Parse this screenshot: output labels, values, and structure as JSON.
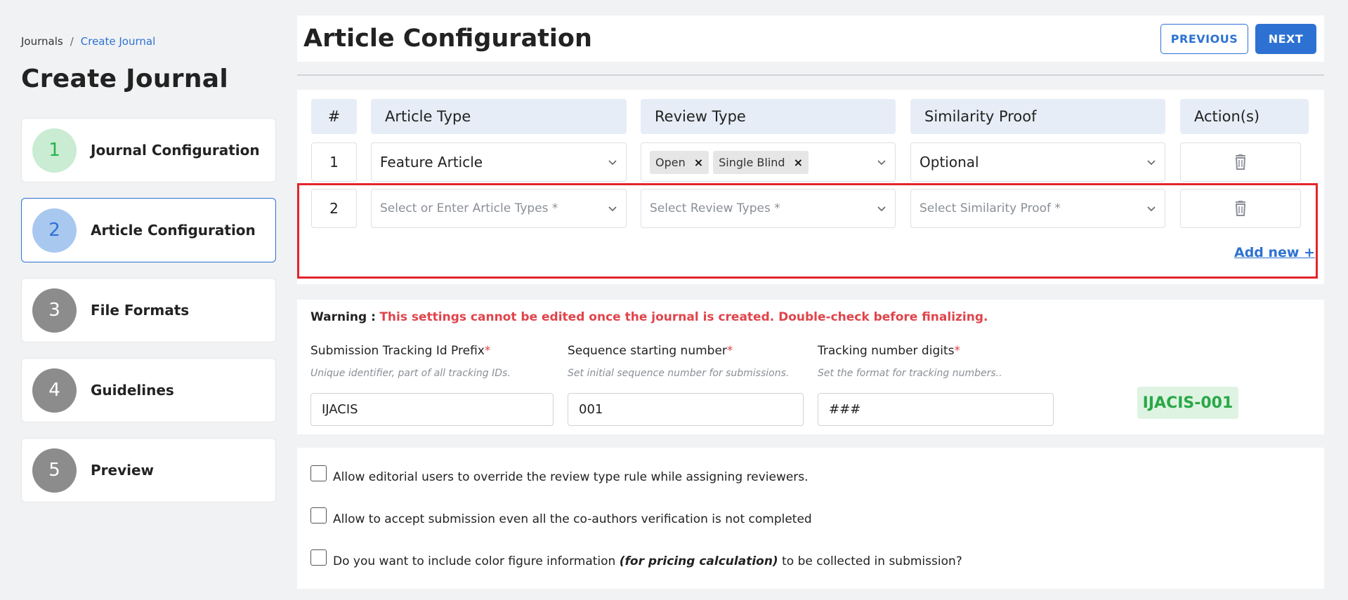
{
  "breadcrumb": {
    "root": "Journals",
    "separator": "/",
    "current": "Create Journal"
  },
  "page_title": "Create Journal",
  "steps": [
    {
      "number": "1",
      "label": "Journal Configuration"
    },
    {
      "number": "2",
      "label": "Article Configuration"
    },
    {
      "number": "3",
      "label": "File Formats"
    },
    {
      "number": "4",
      "label": "Guidelines"
    },
    {
      "number": "5",
      "label": "Preview"
    }
  ],
  "header": {
    "title": "Article Configuration",
    "previous_label": "PREVIOUS",
    "next_label": "NEXT"
  },
  "table": {
    "columns": [
      "#",
      "Article Type",
      "Review Type",
      "Similarity Proof",
      "Action(s)"
    ],
    "rows": [
      {
        "num": "1",
        "article_type": "Feature Article",
        "review_types": [
          "Open",
          "Single Blind"
        ],
        "similarity_proof": "Optional"
      },
      {
        "num": "2",
        "article_type_placeholder": "Select or Enter Article Types *",
        "review_type_placeholder": "Select Review Types *",
        "similarity_proof_placeholder": "Select Similarity Proof *"
      }
    ],
    "add_new_label": "Add new +",
    "chip_remove_glyph": "×"
  },
  "warning": {
    "label": "Warning :",
    "text": "This settings cannot be edited once the journal is created. Double-check before finalizing."
  },
  "tracking": {
    "required_mark": "*",
    "prefix": {
      "label": "Submission Tracking Id Prefix",
      "hint": "Unique identifier, part of all tracking IDs.",
      "value": "IJACIS"
    },
    "sequence": {
      "label": "Sequence starting number",
      "hint": "Set initial sequence number for submissions.",
      "value": "001"
    },
    "digits": {
      "label": "Tracking number digits",
      "hint": "Set the format for tracking numbers..",
      "value": "###"
    },
    "preview": "IJACIS-001"
  },
  "options": {
    "override_review": "Allow editorial users to override the review type rule while assigning reviewers.",
    "accept_unverified": "Allow to accept submission even all the co-authors verification is not completed",
    "color_figure": {
      "before": "Do you want to include color figure information",
      "emphasis": "(for pricing calculation)",
      "after": "to be collected in submission?"
    }
  },
  "colors": {
    "accent": "#2d72d2",
    "warning": "#e0444b",
    "success": "#29a847",
    "highlight": "#e3242b"
  },
  "icons": {
    "dropdown": "chevron-down-icon",
    "delete": "trash-icon"
  }
}
